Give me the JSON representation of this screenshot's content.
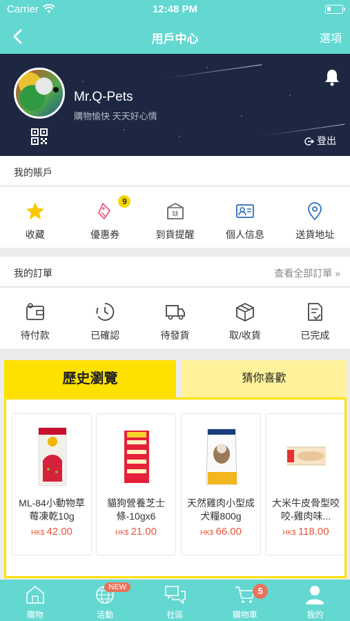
{
  "status_bar": {
    "carrier": "Carrier",
    "time": "12:48 PM"
  },
  "nav": {
    "title": "用戶中心",
    "options_label": "選項"
  },
  "profile": {
    "username": "Mr.Q-Pets",
    "tagline": "購物愉快 天天好心情",
    "logout_label": "登出"
  },
  "account": {
    "section_label": "我的賬戶",
    "items": [
      {
        "label": "收藏",
        "icon": "star-icon"
      },
      {
        "label": "優惠券",
        "icon": "coupon-icon",
        "badge": "9"
      },
      {
        "label": "到貨提醒",
        "icon": "stock-alert-icon"
      },
      {
        "label": "個人信息",
        "icon": "id-card-icon"
      },
      {
        "label": "送貨地址",
        "icon": "location-pin-icon"
      }
    ]
  },
  "orders": {
    "section_label": "我的訂單",
    "view_all": "查看全部訂單 »",
    "items": [
      {
        "label": "待付款",
        "icon": "wallet-icon"
      },
      {
        "label": "已確認",
        "icon": "clock-icon"
      },
      {
        "label": "待發貨",
        "icon": "truck-icon"
      },
      {
        "label": "取/收貨",
        "icon": "box-icon"
      },
      {
        "label": "已完成",
        "icon": "checklist-icon"
      }
    ]
  },
  "browse_tabs": {
    "history": "歷史瀏覽",
    "recommend": "猜你喜歡"
  },
  "products": [
    {
      "name": "ML-84小動物草莓凍乾10g",
      "currency": "HK$",
      "price": "42.00"
    },
    {
      "name": "貓狗營養芝士條-10gx6",
      "currency": "HK$",
      "price": "21.00"
    },
    {
      "name": "天然雞肉小型成犬糧800g",
      "currency": "HK$",
      "price": "66.00"
    },
    {
      "name": "大米牛皮骨型咬咬-雞肉味...",
      "currency": "HK$",
      "price": "118.00"
    }
  ],
  "tab_bar": {
    "items": [
      {
        "label": "購物",
        "icon": "home-icon"
      },
      {
        "label": "活動",
        "icon": "globe-icon",
        "badge": "NEW"
      },
      {
        "label": "社區",
        "icon": "chat-icon"
      },
      {
        "label": "購物車",
        "icon": "cart-icon",
        "badge": "5"
      },
      {
        "label": "我的",
        "icon": "user-icon"
      }
    ]
  },
  "colors": {
    "primary": "#63d8d1",
    "accent_yellow": "#ffe100",
    "price_red": "#e8563a",
    "banner_bg": "#1e2742"
  }
}
